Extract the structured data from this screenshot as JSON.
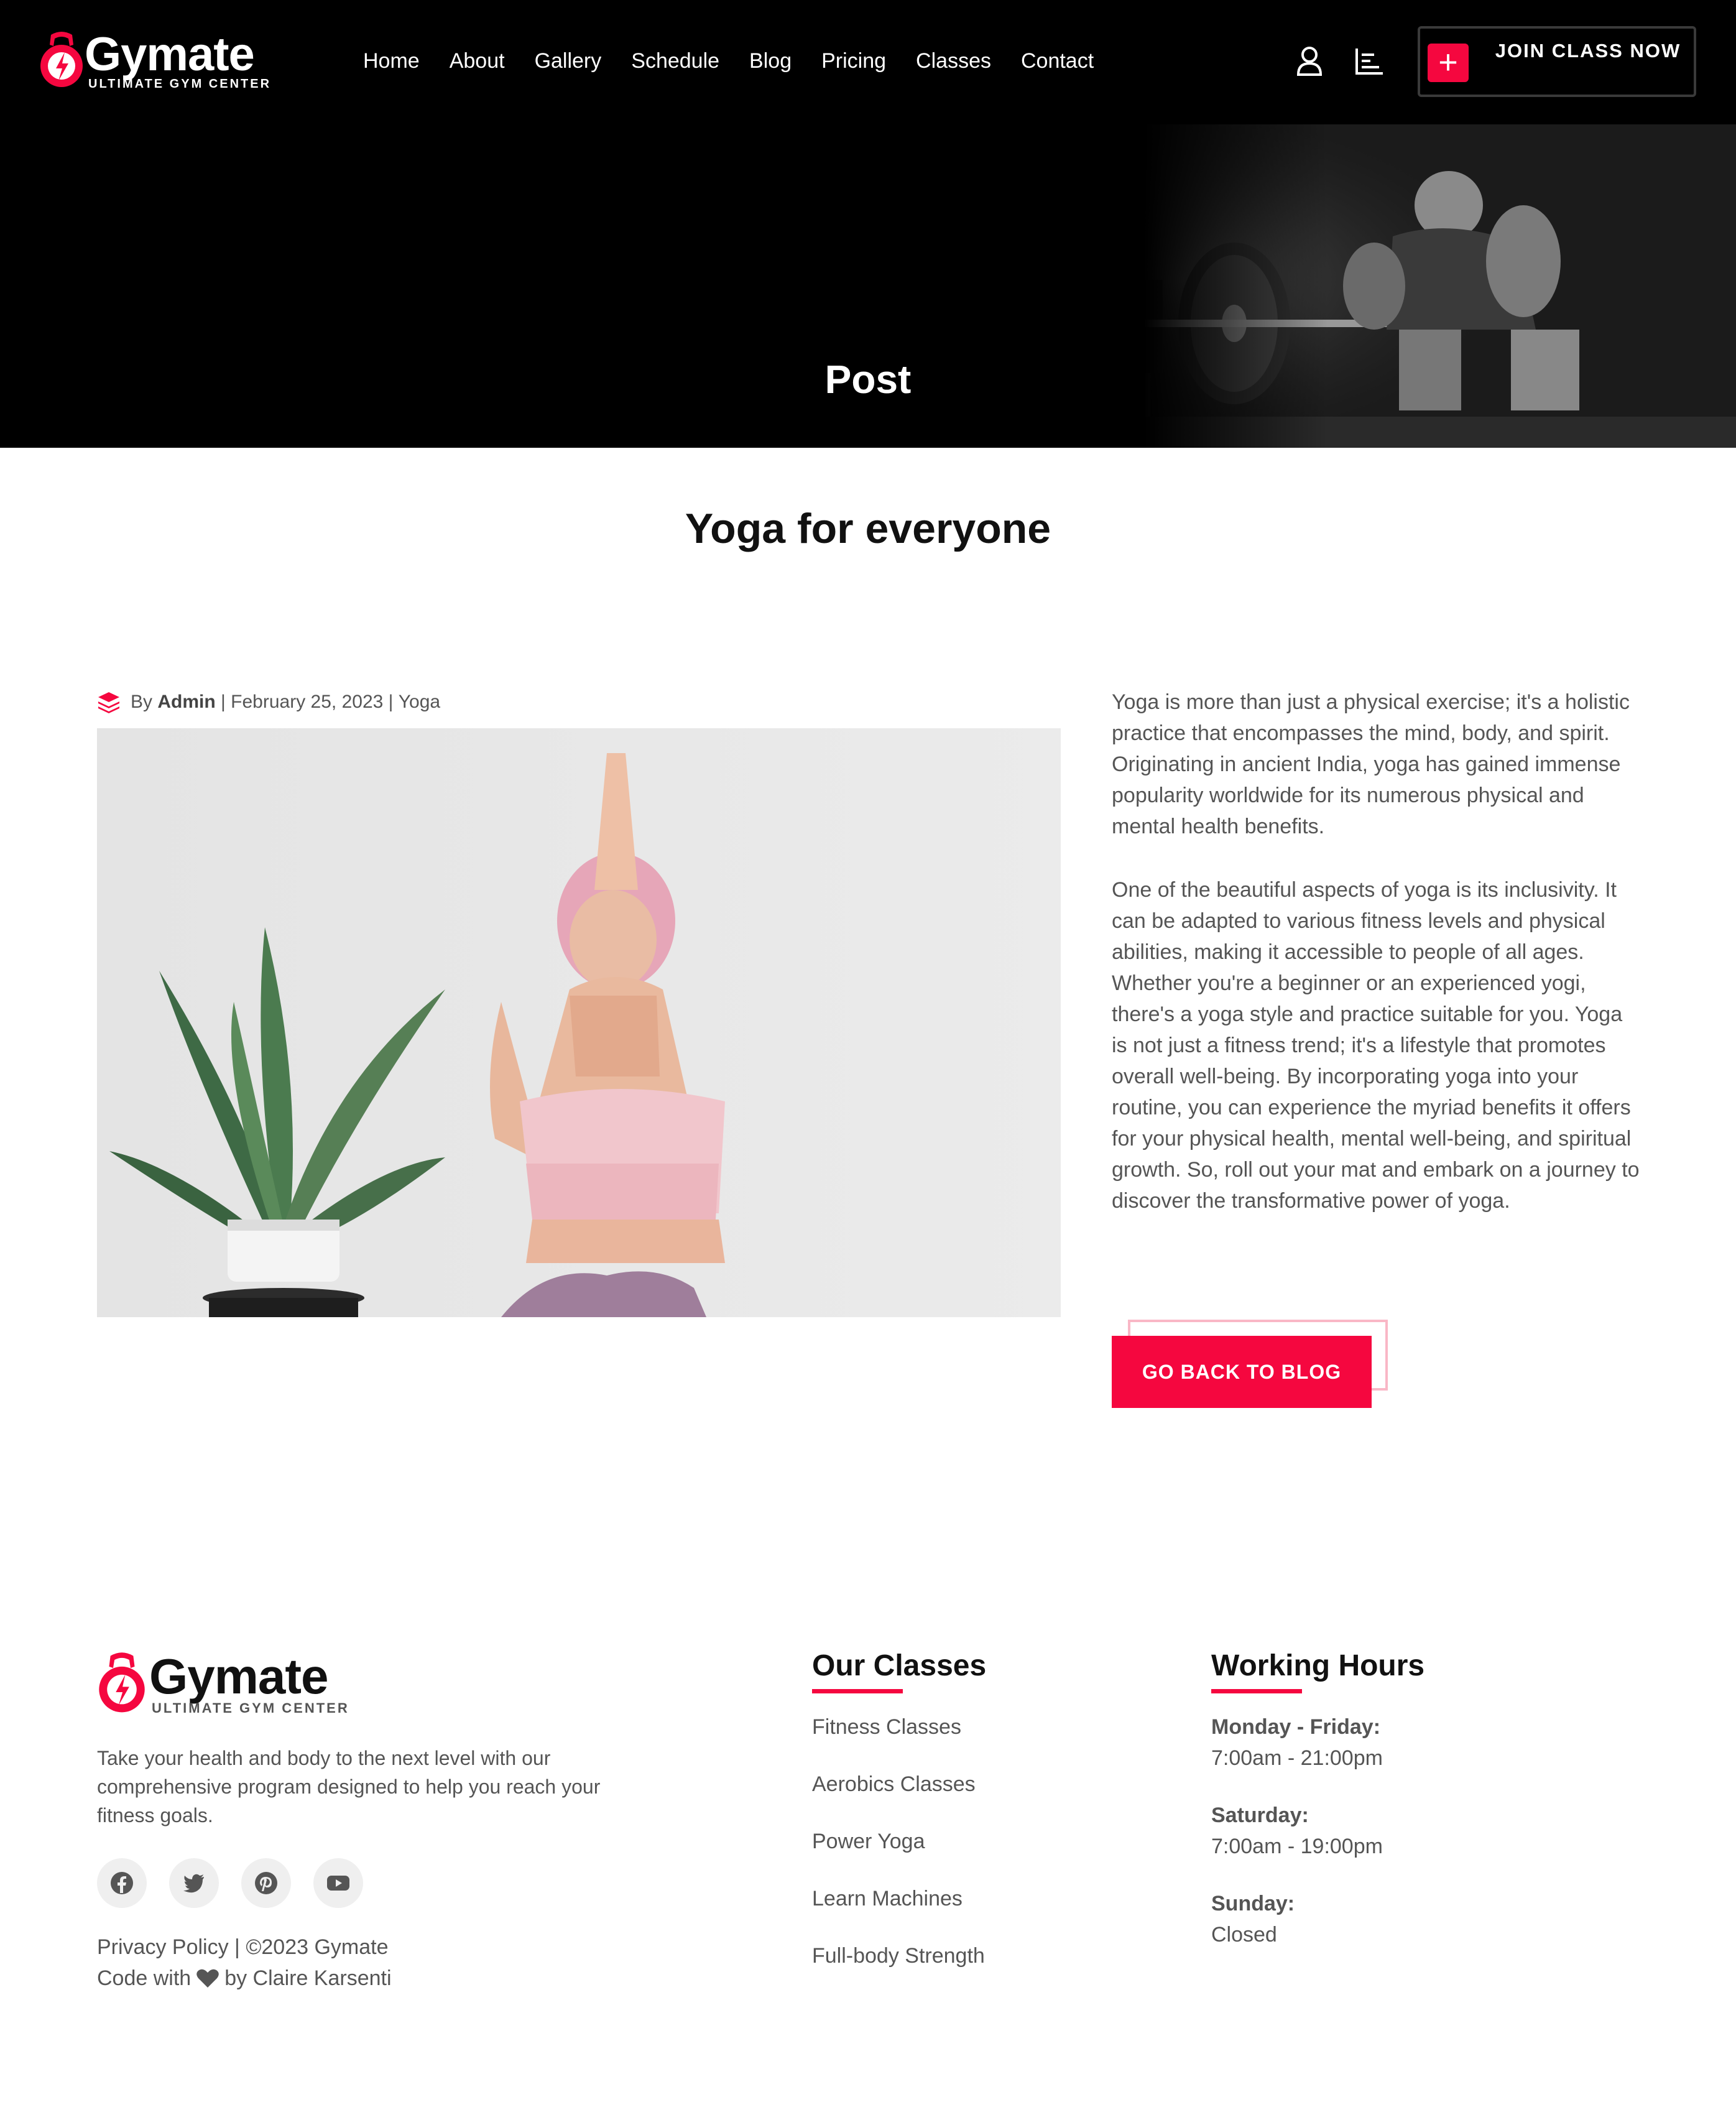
{
  "brand": {
    "name": "Gymate",
    "tagline": "ULTIMATE GYM CENTER",
    "accent": "#f5073f"
  },
  "nav": {
    "items": [
      "Home",
      "About",
      "Gallery",
      "Schedule",
      "Blog",
      "Pricing",
      "Classes",
      "Contact"
    ],
    "icons": [
      "user-icon",
      "stats-icon"
    ],
    "join_label": "JOIN CLASS NOW"
  },
  "hero": {
    "title": "Post"
  },
  "post": {
    "title": "Yoga for everyone",
    "meta": {
      "by": "By ",
      "author": "Admin",
      "date": " | February 25, 2023 | ",
      "category": "Yoga"
    },
    "paragraphs": [
      "Yoga is more than just a physical exercise; it's a holistic practice that encompasses the mind, body, and spirit. Originating in ancient India, yoga has gained immense popularity worldwide for its numerous physical and mental health benefits.",
      "One of the beautiful aspects of yoga is its inclusivity. It can be adapted to various fitness levels and physical abilities, making it accessible to people of all ages. Whether you're a beginner or an experienced yogi, there's a yoga style and practice suitable for you. Yoga is not just a fitness trend; it's a lifestyle that promotes overall well-being. By incorporating yoga into your routine, you can experience the myriad benefits it offers for your physical health, mental well-being, and spiritual growth. So, roll out your mat and embark on a journey to discover the transformative power of yoga."
    ],
    "back_label": "GO BACK TO BLOG"
  },
  "footer": {
    "description": "Take your health and body to the next level with our comprehensive program designed to help you reach your fitness goals.",
    "socials": [
      "facebook-icon",
      "twitter-icon",
      "pinterest-icon",
      "youtube-icon"
    ],
    "copyright": "Privacy Policy | ©2023 Gymate",
    "code_prefix": "Code with",
    "code_suffix": "by Claire Karsenti",
    "classes_title": "Our Classes",
    "classes": [
      "Fitness Classes",
      "Aerobics Classes",
      "Power Yoga",
      "Learn Machines",
      "Full-body Strength"
    ],
    "hours_title": "Working Hours",
    "hours": [
      {
        "day": "Monday - Friday:",
        "time": "7:00am - 21:00pm"
      },
      {
        "day": "Saturday:",
        "time": "7:00am - 19:00pm"
      },
      {
        "day": "Sunday:",
        "time": "Closed"
      }
    ]
  }
}
